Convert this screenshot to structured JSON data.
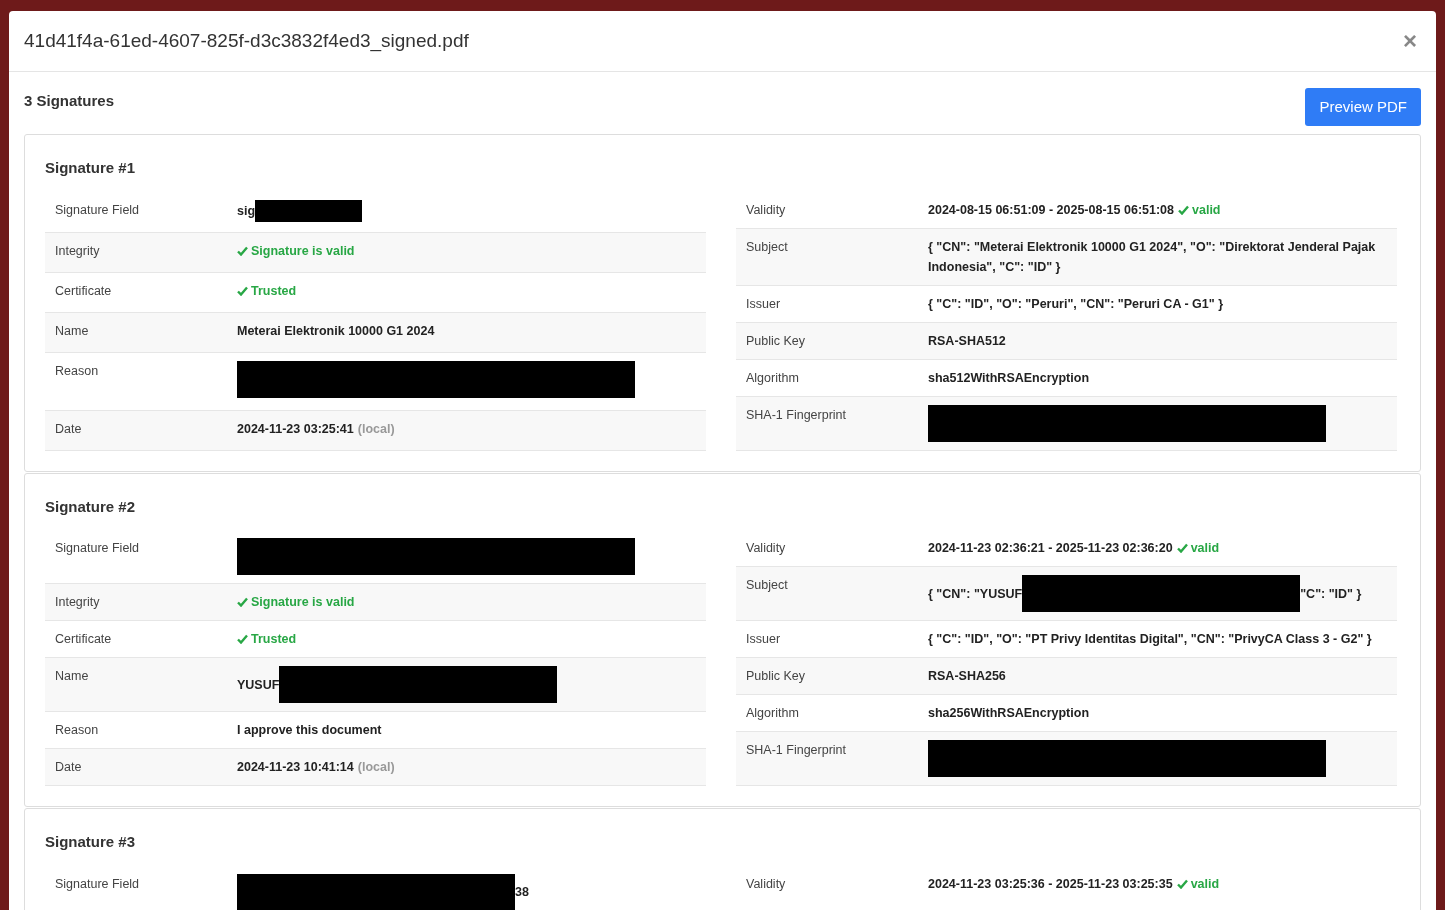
{
  "dialog": {
    "title": "41d41f4a-61ed-4607-825f-d3c3832f4ed3_signed.pdf",
    "close": "×"
  },
  "summary": "3 Signatures",
  "preview_button": "Preview PDF",
  "signatures": [
    {
      "title": "Signature #1",
      "left": [
        {
          "label": "Signature Field",
          "parts": [
            {
              "kind": "text",
              "text": "sig"
            },
            {
              "kind": "short_redaction"
            }
          ]
        },
        {
          "label": "Integrity",
          "parts": [
            {
              "kind": "status",
              "text": "Signature is valid"
            }
          ]
        },
        {
          "label": "Certificate",
          "parts": [
            {
              "kind": "status",
              "text": "Trusted"
            }
          ]
        },
        {
          "label": "Name",
          "parts": [
            {
              "kind": "text",
              "text": "Meterai Elektronik 10000 G1 2024"
            }
          ]
        },
        {
          "label": "Reason",
          "parts": [
            {
              "kind": "long_redaction"
            }
          ]
        },
        {
          "label": "Date",
          "parts": [
            {
              "kind": "text",
              "text": "2024-11-23 03:25:41"
            },
            {
              "kind": "muted",
              "text": "(local)"
            }
          ]
        }
      ],
      "right": [
        {
          "label": "Validity",
          "parts": [
            {
              "kind": "text",
              "text": "2024-08-15 06:51:09 - 2025-08-15 06:51:08"
            },
            {
              "kind": "status",
              "text": "valid"
            }
          ]
        },
        {
          "label": "Subject",
          "parts": [
            {
              "kind": "text",
              "text": "{ \"CN\": \"Meterai Elektronik 10000 G1 2024\", \"O\": \"Direktorat Jenderal Pajak Indonesia\", \"C\": \"ID\" }"
            }
          ]
        },
        {
          "label": "Issuer",
          "parts": [
            {
              "kind": "text",
              "text": "{ \"C\": \"ID\", \"O\": \"Peruri\", \"CN\": \"Peruri CA - G1\" }"
            }
          ]
        },
        {
          "label": "Public Key",
          "parts": [
            {
              "kind": "text",
              "text": "RSA-SHA512"
            }
          ]
        },
        {
          "label": "Algorithm",
          "parts": [
            {
              "kind": "text",
              "text": "sha512WithRSAEncryption"
            }
          ]
        },
        {
          "label": "SHA-1 Fingerprint",
          "parts": [
            {
              "kind": "long_redaction"
            }
          ]
        }
      ]
    },
    {
      "title": "Signature #2",
      "left": [
        {
          "label": "Signature Field",
          "parts": [
            {
              "kind": "long_redaction"
            }
          ]
        },
        {
          "label": "Integrity",
          "parts": [
            {
              "kind": "status",
              "text": "Signature is valid"
            }
          ]
        },
        {
          "label": "Certificate",
          "parts": [
            {
              "kind": "status",
              "text": "Trusted"
            }
          ]
        },
        {
          "label": "Name",
          "parts": [
            {
              "kind": "text",
              "text": "YUSUF"
            },
            {
              "kind": "medium_redaction"
            }
          ]
        },
        {
          "label": "Reason",
          "parts": [
            {
              "kind": "text",
              "text": "I approve this document"
            }
          ]
        },
        {
          "label": "Date",
          "parts": [
            {
              "kind": "text",
              "text": "2024-11-23 10:41:14"
            },
            {
              "kind": "muted",
              "text": "(local)"
            }
          ]
        }
      ],
      "right": [
        {
          "label": "Validity",
          "parts": [
            {
              "kind": "text",
              "text": "2024-11-23 02:36:21 - 2025-11-23 02:36:20"
            },
            {
              "kind": "status",
              "text": "valid"
            }
          ]
        },
        {
          "label": "Subject",
          "parts": [
            {
              "kind": "text",
              "text": "{ \"CN\": \"YUSUF"
            },
            {
              "kind": "medium_redaction"
            },
            {
              "kind": "text",
              "text": "\"C\": \"ID\" }"
            }
          ]
        },
        {
          "label": "Issuer",
          "parts": [
            {
              "kind": "text",
              "text": "{ \"C\": \"ID\", \"O\": \"PT Privy Identitas Digital\", \"CN\": \"PrivyCA Class 3 - G2\" }"
            }
          ]
        },
        {
          "label": "Public Key",
          "parts": [
            {
              "kind": "text",
              "text": "RSA-SHA256"
            }
          ]
        },
        {
          "label": "Algorithm",
          "parts": [
            {
              "kind": "text",
              "text": "sha256WithRSAEncryption"
            }
          ]
        },
        {
          "label": "SHA-1 Fingerprint",
          "parts": [
            {
              "kind": "long_redaction"
            }
          ]
        }
      ]
    },
    {
      "title": "Signature #3",
      "left": [
        {
          "label": "Signature Field",
          "parts": [
            {
              "kind": "medium_redaction"
            },
            {
              "kind": "text",
              "text": "38"
            }
          ]
        }
      ],
      "right": [
        {
          "label": "Validity",
          "parts": [
            {
              "kind": "text",
              "text": "2024-11-23 03:25:36 - 2025-11-23 03:25:35"
            },
            {
              "kind": "status",
              "text": "valid"
            }
          ]
        }
      ]
    }
  ]
}
